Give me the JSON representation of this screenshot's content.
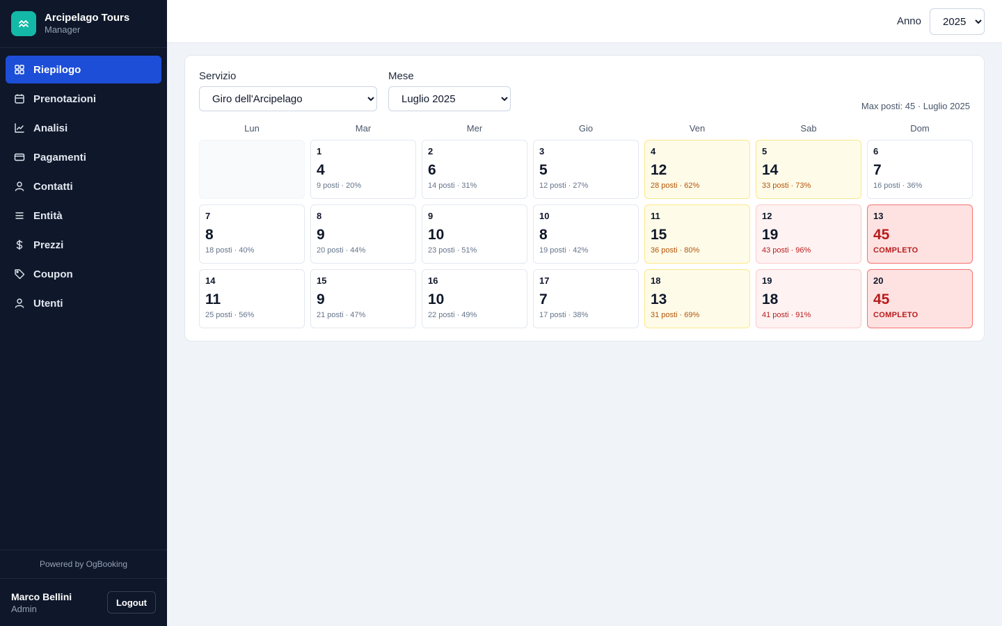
{
  "brand": {
    "title": "Arcipelago Tours",
    "subtitle": "Manager"
  },
  "sidebar": {
    "items": [
      {
        "label": "Riepilogo",
        "icon": "grid-icon"
      },
      {
        "label": "Prenotazioni",
        "icon": "calendar-icon"
      },
      {
        "label": "Analisi",
        "icon": "line-chart-icon"
      },
      {
        "label": "Pagamenti",
        "icon": "credit-card-icon"
      },
      {
        "label": "Contatti",
        "icon": "user-icon"
      },
      {
        "label": "Entità",
        "icon": "list-icon"
      },
      {
        "label": "Prezzi",
        "icon": "dollar-icon"
      },
      {
        "label": "Coupon",
        "icon": "tag-icon"
      },
      {
        "label": "Utenti",
        "icon": "user-icon"
      }
    ],
    "active": "Riepilogo",
    "powered_by": "Powered by OgBooking",
    "user": {
      "name": "Marco Bellini",
      "role": "Admin"
    },
    "logout_label": "Logout"
  },
  "header": {
    "year_label": "Anno",
    "year_value": "2025"
  },
  "filters": {
    "service_label": "Servizio",
    "service_value": "Giro dell'Arcipelago",
    "month_label": "Mese",
    "month_value": "Luglio 2025"
  },
  "max_info": "Max posti: 45 · Luglio 2025",
  "weekdays": [
    "Lun",
    "Mar",
    "Mer",
    "Gio",
    "Ven",
    "Sab",
    "Dom"
  ],
  "colors": {
    "accent": "#1d4ed8",
    "sidebar_bg": "#0f172a",
    "brand_logo": "#14b8a6",
    "warn_bg": "#fefce8",
    "high_bg": "#fef2f2",
    "full_bg": "#fee2e2"
  },
  "calendar": [
    {
      "empty": true
    },
    {
      "day": "1",
      "count": "4",
      "info": "9 posti · 20%",
      "status": "normal"
    },
    {
      "day": "2",
      "count": "6",
      "info": "14 posti · 31%",
      "status": "normal"
    },
    {
      "day": "3",
      "count": "5",
      "info": "12 posti · 27%",
      "status": "normal"
    },
    {
      "day": "4",
      "count": "12",
      "info": "28 posti · 62%",
      "status": "warn"
    },
    {
      "day": "5",
      "count": "14",
      "info": "33 posti · 73%",
      "status": "warn"
    },
    {
      "day": "6",
      "count": "7",
      "info": "16 posti · 36%",
      "status": "normal"
    },
    {
      "day": "7",
      "count": "8",
      "info": "18 posti · 40%",
      "status": "normal"
    },
    {
      "day": "8",
      "count": "9",
      "info": "20 posti · 44%",
      "status": "normal"
    },
    {
      "day": "9",
      "count": "10",
      "info": "23 posti · 51%",
      "status": "normal"
    },
    {
      "day": "10",
      "count": "8",
      "info": "19 posti · 42%",
      "status": "normal"
    },
    {
      "day": "11",
      "count": "15",
      "info": "36 posti · 80%",
      "status": "warn"
    },
    {
      "day": "12",
      "count": "19",
      "info": "43 posti · 96%",
      "status": "high"
    },
    {
      "day": "13",
      "count": "45",
      "info": "COMPLETO",
      "status": "full"
    },
    {
      "day": "14",
      "count": "11",
      "info": "25 posti · 56%",
      "status": "normal"
    },
    {
      "day": "15",
      "count": "9",
      "info": "21 posti · 47%",
      "status": "normal"
    },
    {
      "day": "16",
      "count": "10",
      "info": "22 posti · 49%",
      "status": "normal"
    },
    {
      "day": "17",
      "count": "7",
      "info": "17 posti · 38%",
      "status": "normal"
    },
    {
      "day": "18",
      "count": "13",
      "info": "31 posti · 69%",
      "status": "warn"
    },
    {
      "day": "19",
      "count": "18",
      "info": "41 posti · 91%",
      "status": "high"
    },
    {
      "day": "20",
      "count": "45",
      "info": "COMPLETO",
      "status": "full"
    }
  ]
}
